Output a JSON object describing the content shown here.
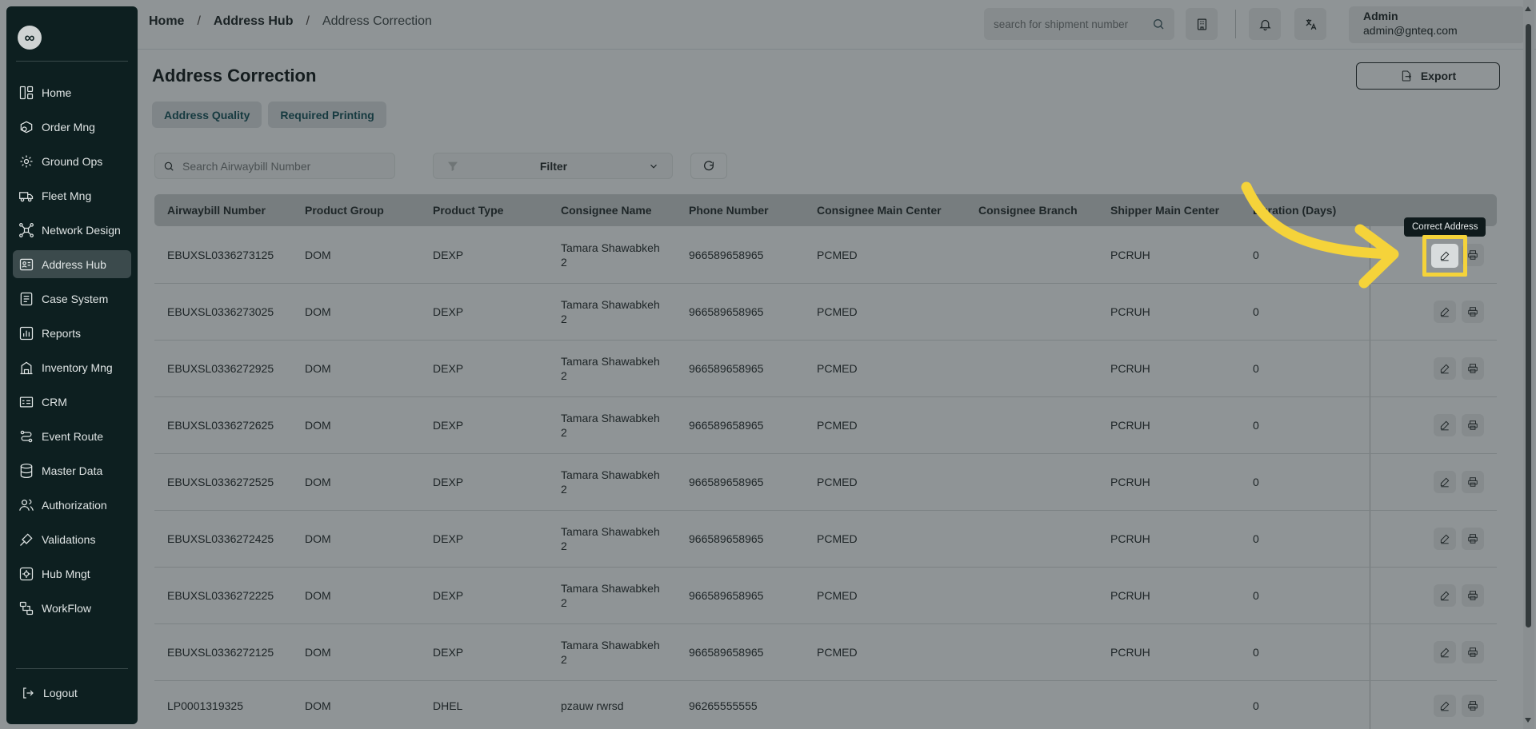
{
  "sidebar": {
    "logo": "∞",
    "items": [
      {
        "label": "Home",
        "icon": "home-grid-icon"
      },
      {
        "label": "Order Mng",
        "icon": "order-icon"
      },
      {
        "label": "Ground Ops",
        "icon": "ground-ops-icon"
      },
      {
        "label": "Fleet Mng",
        "icon": "truck-icon"
      },
      {
        "label": "Network Design",
        "icon": "network-icon"
      },
      {
        "label": "Address Hub",
        "icon": "address-icon"
      },
      {
        "label": "Case System",
        "icon": "case-icon"
      },
      {
        "label": "Reports",
        "icon": "reports-icon"
      },
      {
        "label": "Inventory Mng",
        "icon": "inventory-icon"
      },
      {
        "label": "CRM",
        "icon": "crm-icon"
      },
      {
        "label": "Event Route",
        "icon": "route-icon"
      },
      {
        "label": "Master Data",
        "icon": "database-icon"
      },
      {
        "label": "Authorization",
        "icon": "users-icon"
      },
      {
        "label": "Validations",
        "icon": "validations-icon"
      },
      {
        "label": "Hub Mngt",
        "icon": "hub-icon"
      },
      {
        "label": "WorkFlow",
        "icon": "workflow-icon"
      }
    ],
    "active_index": 5,
    "logout": "Logout"
  },
  "header": {
    "breadcrumb": [
      "Home",
      "Address Hub",
      "Address Correction"
    ],
    "search_placeholder": "search for shipment number",
    "user_name": "Admin",
    "user_email": "admin@gnteq.com"
  },
  "page": {
    "title": "Address Correction",
    "export_label": "Export",
    "tabs": [
      "Address Quality",
      "Required Printing"
    ],
    "awb_search_placeholder": "Search Airwaybill Number",
    "filter_label": "Filter"
  },
  "table": {
    "columns": [
      "Airwaybill Number",
      "Product Group",
      "Product Type",
      "Consignee Name",
      "Phone Number",
      "Consignee Main Center",
      "Consignee Branch",
      "Shipper Main Center",
      "Duration (Days)"
    ],
    "rows": [
      [
        "EBUXSL0336273125",
        "DOM",
        "DEXP",
        "Tamara Shawabkeh 2",
        "966589658965",
        "PCMED",
        "",
        "PCRUH",
        "0"
      ],
      [
        "EBUXSL0336273025",
        "DOM",
        "DEXP",
        "Tamara Shawabkeh 2",
        "966589658965",
        "PCMED",
        "",
        "PCRUH",
        "0"
      ],
      [
        "EBUXSL0336272925",
        "DOM",
        "DEXP",
        "Tamara Shawabkeh 2",
        "966589658965",
        "PCMED",
        "",
        "PCRUH",
        "0"
      ],
      [
        "EBUXSL0336272625",
        "DOM",
        "DEXP",
        "Tamara Shawabkeh 2",
        "966589658965",
        "PCMED",
        "",
        "PCRUH",
        "0"
      ],
      [
        "EBUXSL0336272525",
        "DOM",
        "DEXP",
        "Tamara Shawabkeh 2",
        "966589658965",
        "PCMED",
        "",
        "PCRUH",
        "0"
      ],
      [
        "EBUXSL0336272425",
        "DOM",
        "DEXP",
        "Tamara Shawabkeh 2",
        "966589658965",
        "PCMED",
        "",
        "PCRUH",
        "0"
      ],
      [
        "EBUXSL0336272225",
        "DOM",
        "DEXP",
        "Tamara Shawabkeh 2",
        "966589658965",
        "PCMED",
        "",
        "PCRUH",
        "0"
      ],
      [
        "EBUXSL0336272125",
        "DOM",
        "DEXP",
        "Tamara Shawabkeh 2",
        "966589658965",
        "PCMED",
        "",
        "PCRUH",
        "0"
      ],
      [
        "LP0001319325",
        "DOM",
        "DHEL",
        "pzauw rwrsd",
        "96265555555",
        "",
        "",
        "",
        "0"
      ]
    ],
    "tooltip": "Correct Address"
  },
  "colors": {
    "sidebar_bg": "#0d1f20",
    "highlight": "#f5d33a"
  }
}
